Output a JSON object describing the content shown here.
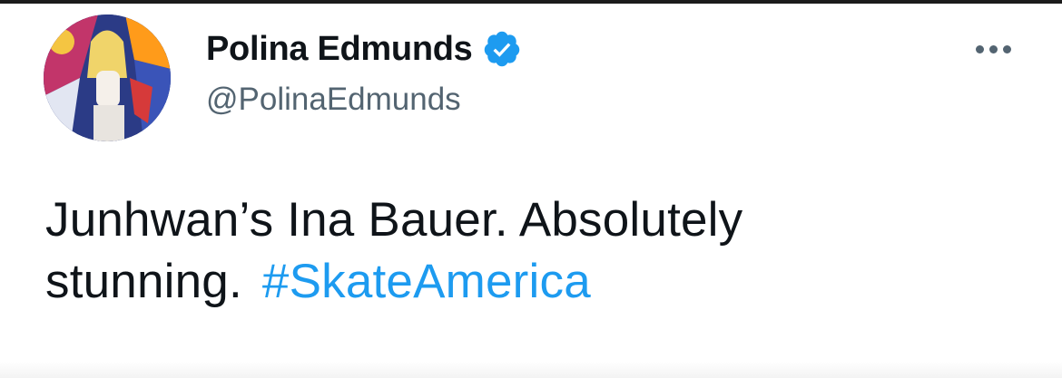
{
  "tweet": {
    "author": {
      "display_name": "Polina Edmunds",
      "handle": "@PolinaEdmunds",
      "verified": true,
      "avatar_icon": "profile-photo"
    },
    "more_icon": "more-options-icon",
    "text_line1": "Junhwan’s Ina Bauer. Absolutely",
    "text_line2": "stunning.",
    "hashtag": "#SkateAmerica"
  },
  "colors": {
    "text": "#0f1419",
    "secondary": "#536471",
    "link": "#1d9bf0",
    "verified_badge": "#1d9bf0"
  }
}
